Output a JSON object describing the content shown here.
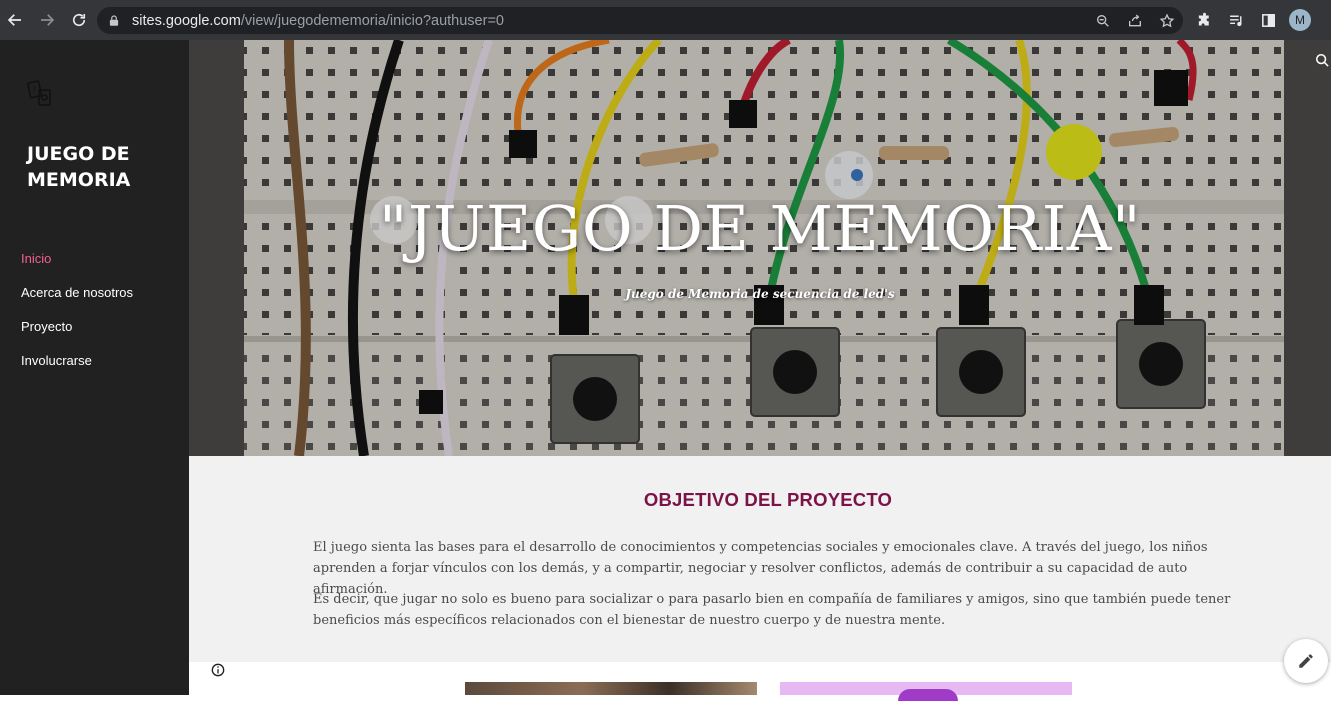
{
  "browser": {
    "url_host": "sites.google.com",
    "url_path": "/view/juegodememoria/inicio?authuser=0",
    "avatar_letter": "M",
    "icons": [
      "back-icon",
      "forward-icon",
      "reload-icon",
      "lock-icon",
      "zoom-icon",
      "share-icon",
      "star-icon",
      "extensions-icon",
      "media-icon",
      "side-panel-icon"
    ]
  },
  "sidebar": {
    "logo_icon": "memory-cards-icon",
    "site_title": "JUEGO DE MEMORIA",
    "items": [
      {
        "label": "Inicio",
        "active": true
      },
      {
        "label": "Acerca de nosotros",
        "active": false
      },
      {
        "label": "Proyecto",
        "active": false
      },
      {
        "label": "Involucrarse",
        "active": false
      }
    ]
  },
  "hero": {
    "title": "\"JUEGO DE MEMORIA\"",
    "subtitle": "Juego de Memoria de secuencia de led's"
  },
  "section": {
    "title": "OBJETIVO DEL PROYECTO",
    "paragraph_1": "El juego sienta las bases para el desarrollo de conocimientos y competencias sociales y emocionales clave. A través del juego, los niños aprenden a forjar vínculos con los demás, y a compartir, negociar y resolver conflictos, además de contribuir a su capacidad de auto afirmación.",
    "paragraph_2": "Es decir, que jugar no solo es bueno para socializar o para pasarlo bien en compañía de familiares y amigos, sino que también puede tener beneficios más específicos relacionados con el bienestar de nuestro cuerpo y de nuestra mente."
  },
  "colors": {
    "sidebar_bg": "#212121",
    "active_nav": "#f06292",
    "section_title": "#7b1346",
    "content_bg": "#f1f1f1"
  }
}
